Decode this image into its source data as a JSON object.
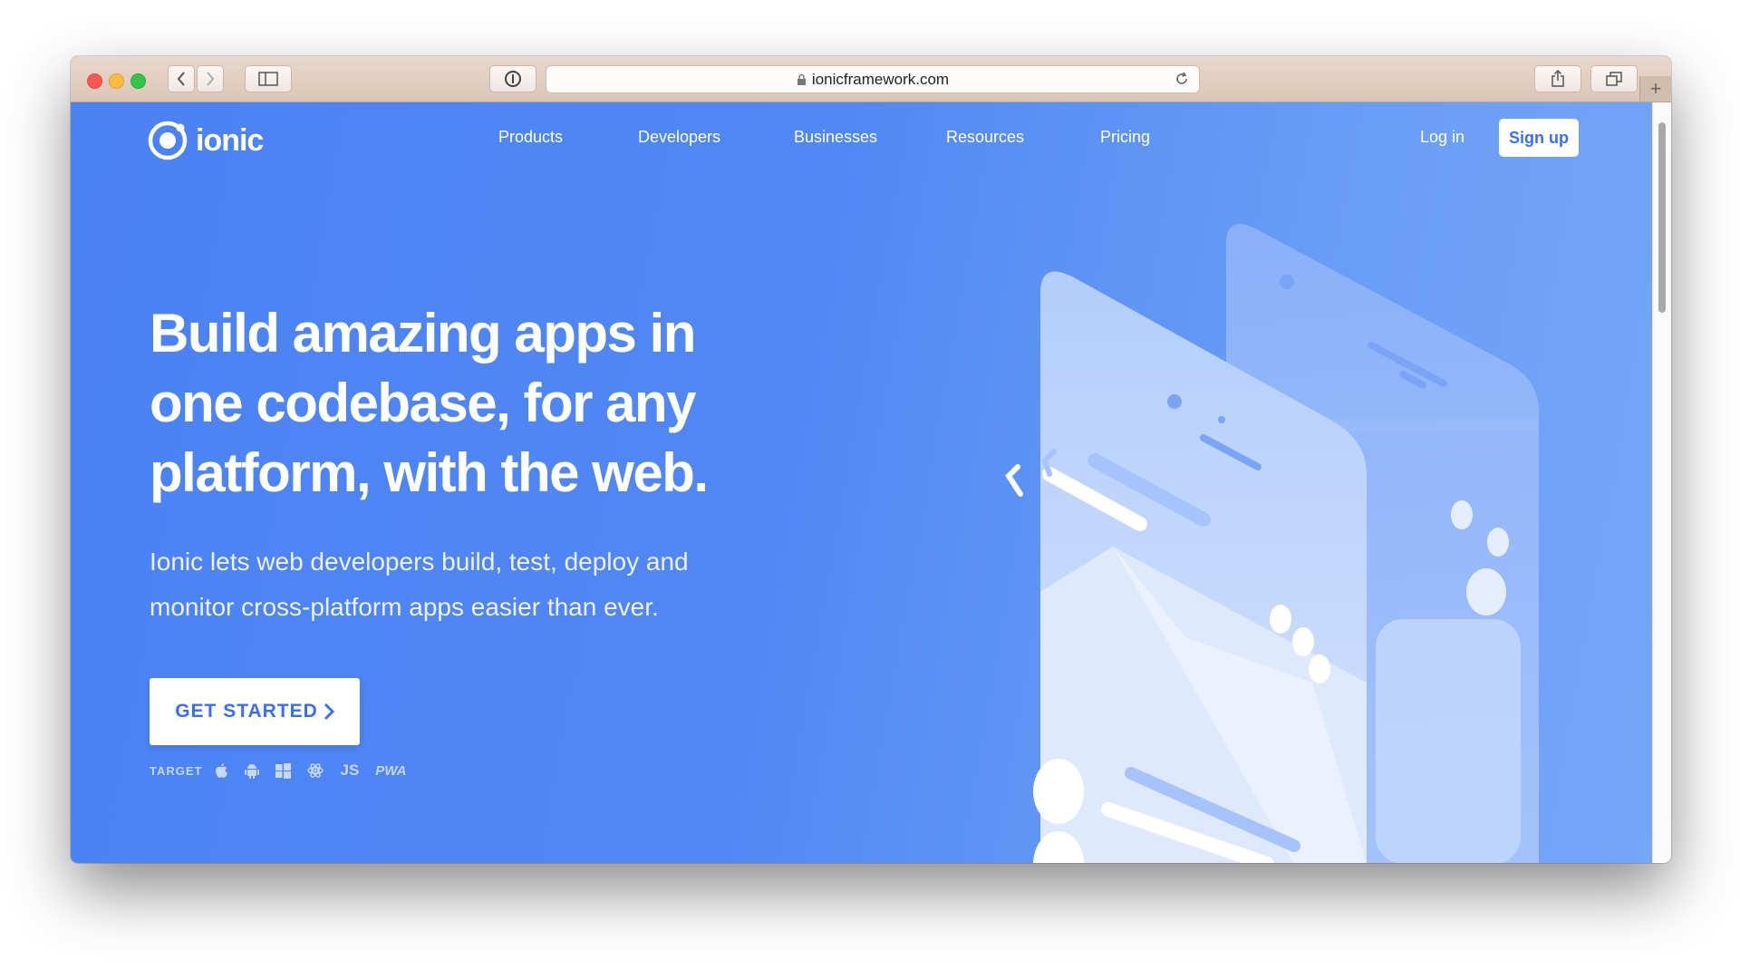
{
  "browser": {
    "url": "ionicframework.com"
  },
  "nav": {
    "brand": "ionic",
    "links": [
      {
        "label": "Products"
      },
      {
        "label": "Developers"
      },
      {
        "label": "Businesses"
      },
      {
        "label": "Resources"
      },
      {
        "label": "Pricing"
      }
    ],
    "login": "Log in",
    "signup": "Sign up"
  },
  "hero": {
    "title_lines": [
      "Build amazing apps in",
      "one codebase, for any",
      "platform, with the web."
    ],
    "subtitle_lines": [
      "Ionic lets web developers build, test, deploy and",
      "monitor cross-platform apps easier than ever."
    ],
    "cta": "GET STARTED",
    "targets_label": "TARGET",
    "targets": [
      {
        "icon": "apple-icon"
      },
      {
        "icon": "android-icon"
      },
      {
        "icon": "windows-icon"
      },
      {
        "icon": "electron-icon"
      },
      {
        "icon": "js-icon",
        "text": "JS"
      },
      {
        "icon": "pwa-icon",
        "text": "PWA"
      }
    ]
  },
  "colors": {
    "brand_blue": "#4b82f4",
    "button_text": "#3a6ff0"
  }
}
